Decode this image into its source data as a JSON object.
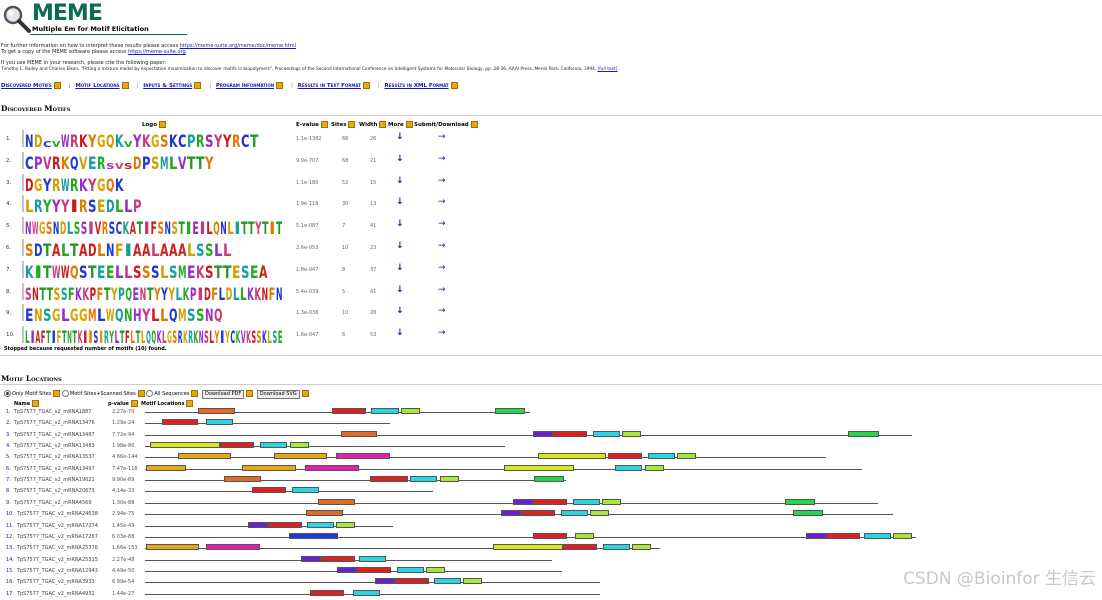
{
  "header": {
    "title": "MEME",
    "subtitle": "Multiple Em for Motif Elicitation"
  },
  "info": {
    "line1_text": "For further information on how to interpret these results please access ",
    "line1_link": "https://meme-suite.org/meme/doc/meme.html",
    "line2_text": "To get a copy of the MEME software please access ",
    "line2_link": "https://meme-suite.org",
    "line3": "If you use MEME in your research, please cite the following paper:",
    "citation": "Timothy L. Bailey and Charles Elkan, \"Fitting a mixture model by expectation maximization to discover motifs in biopolymers\", Proceedings of the Second International Conference on Intelligent Systems for Molecular Biology, pp. 28-36, AAAI Press, Menlo Park, California, 1994.",
    "citation_link": "[full text]"
  },
  "nav": [
    {
      "label": "Discovered Motifs"
    },
    {
      "label": "Motif Locations"
    },
    {
      "label": "Inputs & Settings"
    },
    {
      "label": "Program Information"
    },
    {
      "label": "Results in Text Format"
    },
    {
      "label": "Results in XML Format"
    }
  ],
  "discovered": {
    "title": "Discovered Motifs",
    "columns": {
      "logo": "Logo",
      "evalue": "E-value",
      "sites": "Sites",
      "width": "Width",
      "more": "More",
      "submit": "Submit/Download"
    },
    "more_glyph": "↓",
    "submit_glyph": "→",
    "motifs": [
      {
        "idx": "1.",
        "consensus": "NDcvWRKYGQKvYKGSKCPRSYYRCT",
        "evalue": "1.1e-1382",
        "sites": "66",
        "width": "26"
      },
      {
        "idx": "2.",
        "consensus": "CPVRKQVERsvsDPSMLVTTY",
        "evalue": "9.0e-707",
        "sites": "68",
        "width": "21"
      },
      {
        "idx": "3.",
        "consensus": "DGYRWRKYGQK",
        "evalue": "1.1e-180",
        "sites": "52",
        "width": "15"
      },
      {
        "idx": "4.",
        "consensus": "LRYYYIRSEDLLP",
        "evalue": "1.9e-118",
        "sites": "30",
        "width": "13"
      },
      {
        "idx": "5.",
        "consensus": "NWGSNDLSSIVRSCKATIFSNSTIEILQNLITTYTIT",
        "evalue": "5.1e-087",
        "sites": "7",
        "width": "41"
      },
      {
        "idx": "6.",
        "consensus": "SDTALTADLNFIAALAAALSSLL",
        "evalue": "2.6e-053",
        "sites": "10",
        "width": "23"
      },
      {
        "idx": "7.",
        "consensus": "KITWWQSTEELLSSSLSMEKSTTESEA",
        "evalue": "1.8e-047",
        "sites": "8",
        "width": "37"
      },
      {
        "idx": "8.",
        "consensus": "SNTTSSFKKPFTYPQENTYYYLKPIDFLDLLKKNFN",
        "evalue": "5.4e-039",
        "sites": "5",
        "width": "41"
      },
      {
        "idx": "9.",
        "consensus": "ENSGLGGMLWQNHYLLQMSSNQ",
        "evalue": "1.3e-036",
        "sites": "10",
        "width": "28"
      },
      {
        "idx": "10.",
        "consensus": "LIAFTIFTNTKIISIRYLTFLTLQQKLGSRKRKNSLYIYCKVKSSKLSE",
        "evalue": "1.6e-047",
        "sites": "6",
        "width": "53"
      }
    ],
    "stopped": "Stopped because requested number of motifs (10) found."
  },
  "locations": {
    "title": "Motif Locations",
    "controls": {
      "opt1": "Only Motif Sites",
      "opt2": "Motif Sites+Scanned Sites",
      "opt3": "All Sequences",
      "btn_pdf": "Download PDF",
      "btn_svg": "Download SVG"
    },
    "columns": {
      "name": "Name",
      "pvalue": "p-value",
      "loc": "Motif Locations"
    },
    "rows": [
      {
        "idx": "1.",
        "name": "TpS7577_TGAC_v2_mRNA1887",
        "pvalue": "2.27e-70"
      },
      {
        "idx": "2.",
        "name": "TpS7577_TGAC_v2_mRNA13476",
        "pvalue": "1.29e-24"
      },
      {
        "idx": "3.",
        "name": "TpS7577_TGAC_v2_mRNA13487",
        "pvalue": "7.72e-94"
      },
      {
        "idx": "4.",
        "name": "TpS7577_TGAC_v2_mRNA13483",
        "pvalue": "1.98e-80"
      },
      {
        "idx": "5.",
        "name": "TpS7577_TGAC_v2_mRNA13537",
        "pvalue": "4.66e-144"
      },
      {
        "idx": "6.",
        "name": "TpS7577_TGAC_v2_mRNA13497",
        "pvalue": "7.47e-118"
      },
      {
        "idx": "7.",
        "name": "TpS7577_TGAC_v2_mRNA19621",
        "pvalue": "9.90e-69"
      },
      {
        "idx": "8.",
        "name": "TpS7577_TGAC_v2_mRNA20673",
        "pvalue": "4.14e-33"
      },
      {
        "idx": "9.",
        "name": "TpS7577_TGAC_v2_mRNA4569",
        "pvalue": "1.30e-88"
      },
      {
        "idx": "10.",
        "name": "TpS7577_TGAC_v2_mRNA24638",
        "pvalue": "2.94e-75"
      },
      {
        "idx": "11.",
        "name": "TpS7577_TGAC_v2_mRNA17274",
        "pvalue": "1.45e-49"
      },
      {
        "idx": "12.",
        "name": "TpS7577_TGAC_v2_mRNA17267",
        "pvalue": "6.03e-88"
      },
      {
        "idx": "13.",
        "name": "TpS7577_TGAC_v2_mRNA25376",
        "pvalue": "1.66e-153"
      },
      {
        "idx": "14.",
        "name": "TpS7577_TGAC_v2_mRNA25315",
        "pvalue": "2.27e-48"
      },
      {
        "idx": "15.",
        "name": "TpS7577_TGAC_v2_mRNA12943",
        "pvalue": "4.49e-50"
      },
      {
        "idx": "16.",
        "name": "TpS7577_TGAC_v2_mRNA3933",
        "pvalue": "6.99e-54"
      },
      {
        "idx": "17.",
        "name": "TpS7577_TGAC_v2_mRNA4932",
        "pvalue": "1.44e-27"
      }
    ],
    "motif_colors": {
      "m1": "#e02020",
      "m2": "#28d6e6",
      "m3": "#e36a24",
      "m4": "#a8e63c",
      "m5": "#26d64a",
      "m6": "#e6a817",
      "m7": "#e020b0",
      "m8": "#d8e81e",
      "m9": "#6a1fd0",
      "m10": "#1b3bd0"
    }
  },
  "watermark": "CSDN @Bioinfor 生信云"
}
